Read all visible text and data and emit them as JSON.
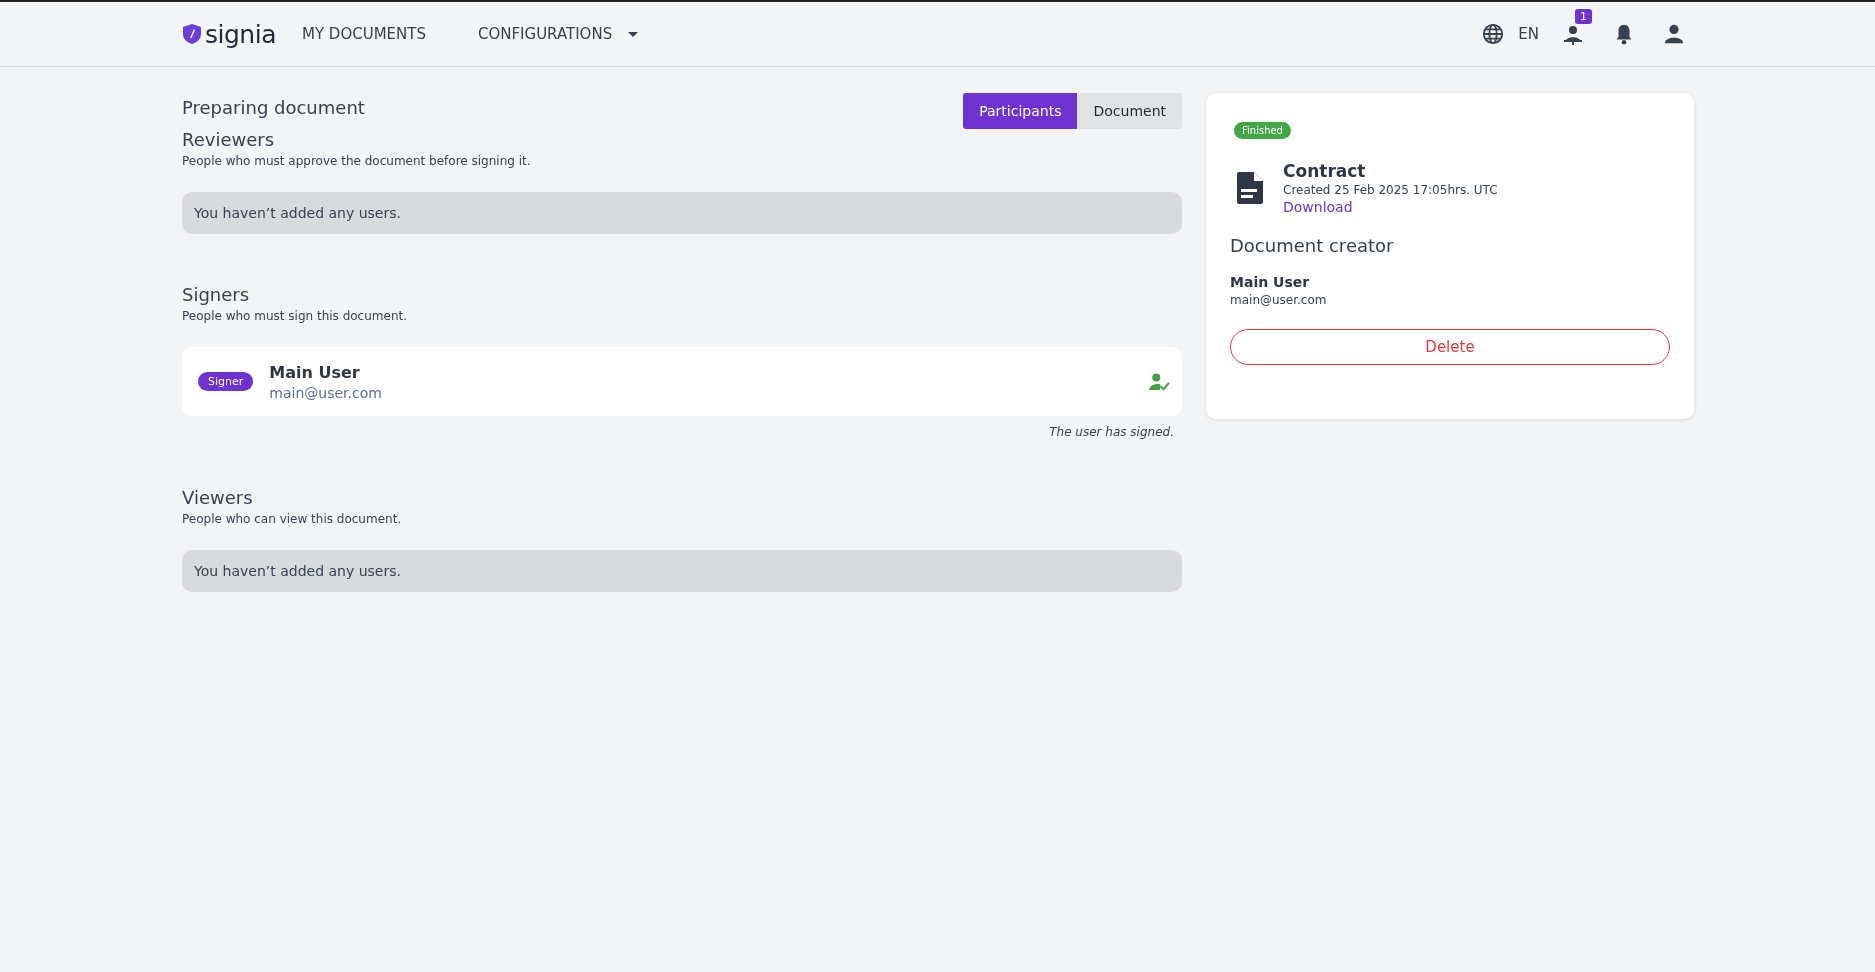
{
  "header": {
    "logo": "signia",
    "nav": [
      {
        "label": "MY DOCUMENTS",
        "kind": "link"
      },
      {
        "label": "CONFIGURATIONS",
        "kind": "dropdown"
      }
    ],
    "language": "EN",
    "pending_badge": "1"
  },
  "main": {
    "title": "Preparing document",
    "tabs": [
      {
        "label": "Participants",
        "selected": true
      },
      {
        "label": "Document",
        "selected": false
      }
    ],
    "sections": [
      {
        "title": "Reviewers",
        "subtitle": "People who must approve the document before signing it.",
        "empty_message": "You haven’t added any users."
      },
      {
        "title": "Signers",
        "subtitle": "People who must sign this document.",
        "participants": [
          {
            "role": "Signer",
            "name": "Main User",
            "email": "main@user.com",
            "signed": true,
            "note": "The user has signed."
          }
        ]
      },
      {
        "title": "Viewers",
        "subtitle": "People who can view this document.",
        "empty_message": "You haven’t added any users."
      }
    ]
  },
  "document_card": {
    "status": "Finished",
    "title": "Contract",
    "created": "Created 25 Feb 2025 17:05hrs. UTC",
    "download": "Download",
    "creator_heading": "Document creator",
    "creator_name": "Main User",
    "creator_email": "main@user.com",
    "delete": "Delete"
  }
}
